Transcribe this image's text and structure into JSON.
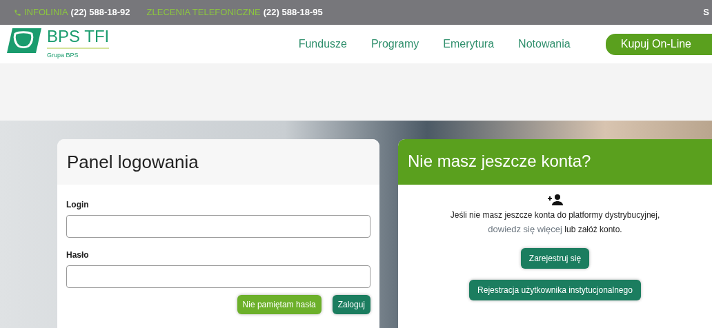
{
  "top_bar": {
    "items": [
      {
        "label": "INFOLINIA",
        "number": "(22) 588-18-92",
        "icon": true
      },
      {
        "label": "ZLECENIA TELEFONICZNE",
        "number": "(22) 588-18-95",
        "icon": false
      }
    ],
    "right_text": "S"
  },
  "header": {
    "logo_title": "BPS TFI",
    "logo_subtitle": "Grupa BPS",
    "nav": [
      "Fundusze",
      "Programy",
      "Emerytura",
      "Notowania"
    ],
    "cta": "Kupuj On-Line"
  },
  "login_panel": {
    "title": "Panel logowania",
    "fields": [
      {
        "label": "Login"
      },
      {
        "label": "Hasło"
      }
    ],
    "buttons": [
      {
        "label": "Nie pamiętam hasła",
        "kind": "secondary"
      },
      {
        "label": "Zaloguj",
        "kind": "primary"
      }
    ]
  },
  "register_panel": {
    "title": "Nie masz jeszcze konta?",
    "text_before": "Jeśli nie masz jeszcze konta do platformy dystrybucyjnej,",
    "link": "dowiedz się więcej",
    "text_after": "lub załóż konto.",
    "buttons": [
      "Zarejestruj się",
      "Rejestracja użytkownika instytucjonalnego"
    ]
  }
}
